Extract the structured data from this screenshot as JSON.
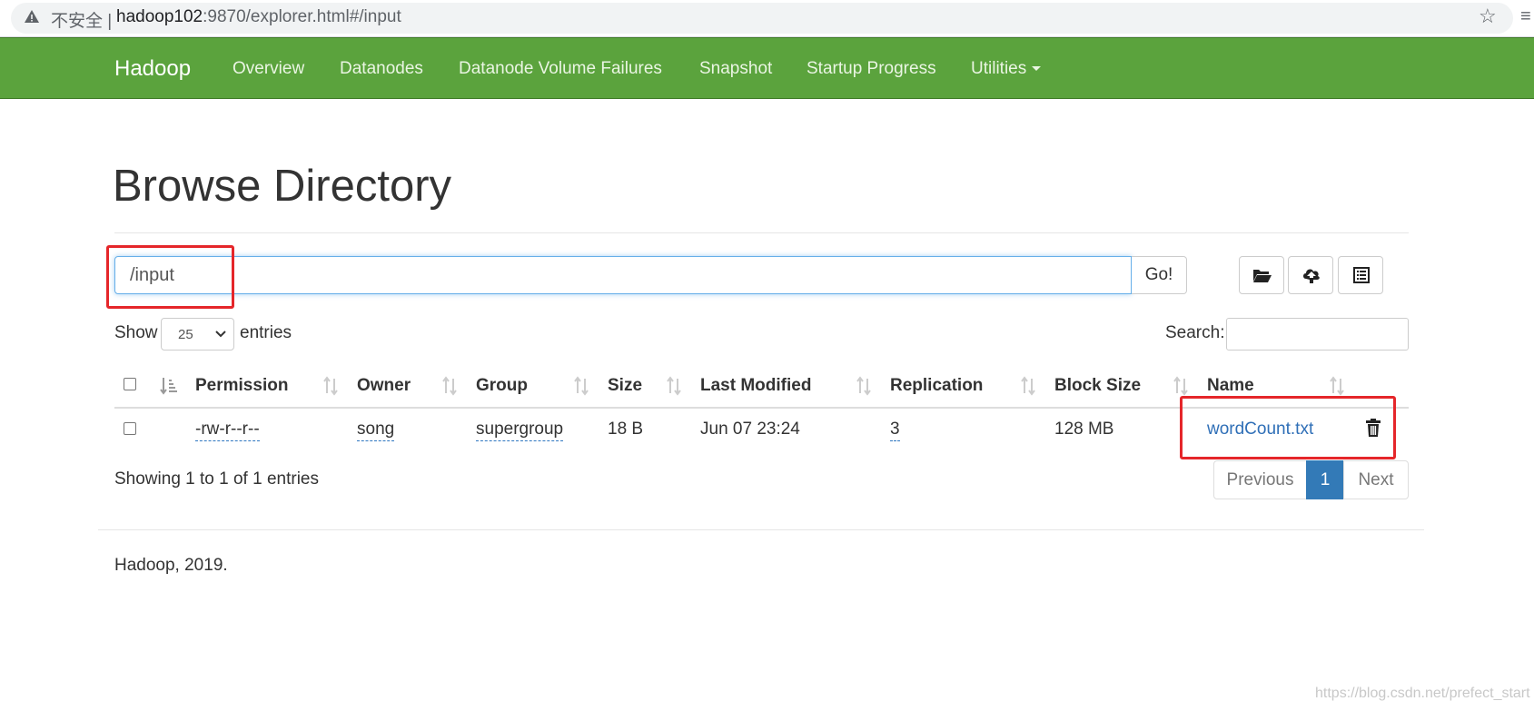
{
  "browser": {
    "security_label": "不安全 |",
    "url_host": "hadoop102",
    "url_rest": ":9870/explorer.html#/input"
  },
  "navbar": {
    "brand": "Hadoop",
    "items": [
      {
        "label": "Overview"
      },
      {
        "label": "Datanodes"
      },
      {
        "label": "Datanode Volume Failures"
      },
      {
        "label": "Snapshot"
      },
      {
        "label": "Startup Progress"
      },
      {
        "label": "Utilities"
      }
    ],
    "color": "#5ba33d"
  },
  "page": {
    "title": "Browse Directory"
  },
  "path_bar": {
    "value": "/input",
    "go_label": "Go!",
    "icons": [
      "folder-open-icon",
      "cloud-upload-icon",
      "list-alt-icon"
    ]
  },
  "controls": {
    "show_label": "Show",
    "entries_value": "25",
    "entries_label": "entries",
    "search_label": "Search:"
  },
  "table": {
    "columns": [
      "Permission",
      "Owner",
      "Group",
      "Size",
      "Last Modified",
      "Replication",
      "Block Size",
      "Name"
    ],
    "rows": [
      {
        "permission": "-rw-r--r--",
        "owner": "song",
        "group": "supergroup",
        "size": "18 B",
        "last_modified": "Jun 07 23:24",
        "replication": "3",
        "block_size": "128 MB",
        "name": "wordCount.txt"
      }
    ]
  },
  "footer_info": {
    "showing": "Showing 1 to 1 of 1 entries",
    "prev": "Previous",
    "page": "1",
    "next": "Next",
    "copyright": "Hadoop, 2019."
  },
  "watermark": "https://blog.csdn.net/prefect_start",
  "colors": {
    "link": "#2f6fb7",
    "active_page": "#337ab7",
    "annotation": "#e5262a"
  }
}
